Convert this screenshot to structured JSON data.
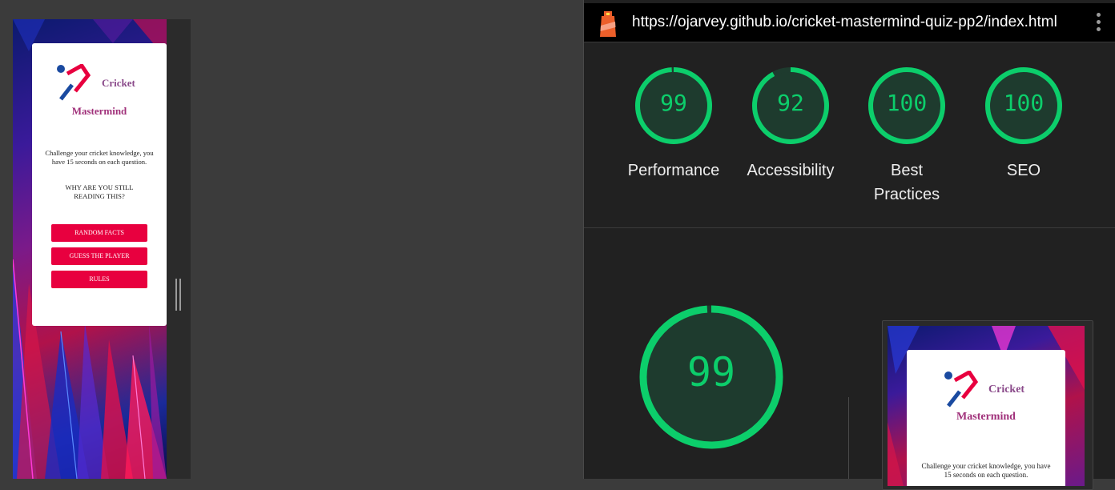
{
  "preview": {
    "brand_line1": "Cricket",
    "brand_line2": "Mastermind",
    "intro": "Challenge your cricket knowledge, you have 15 seconds on each question.",
    "warning": "WHY ARE YOU STILL READING THIS?",
    "buttons": [
      "RANDOM FACTS",
      "GUESS THE PLAYER",
      "RULES"
    ],
    "button_color": "#e8003f",
    "brand_color": "#a0307a"
  },
  "lighthouse": {
    "url": "https://ojarvey.github.io/cricket-mastermind-quiz-pp2/index.html",
    "logo_icon": "lighthouse-icon",
    "menu_icon": "more-vert-icon",
    "pass_color": "#0cce6b",
    "scores": [
      {
        "value": 99,
        "label": "Performance"
      },
      {
        "value": 92,
        "label": "Accessibility"
      },
      {
        "value": 100,
        "label": "Best Practices"
      },
      {
        "value": 100,
        "label": "SEO"
      }
    ],
    "detail": {
      "value": 99
    }
  }
}
